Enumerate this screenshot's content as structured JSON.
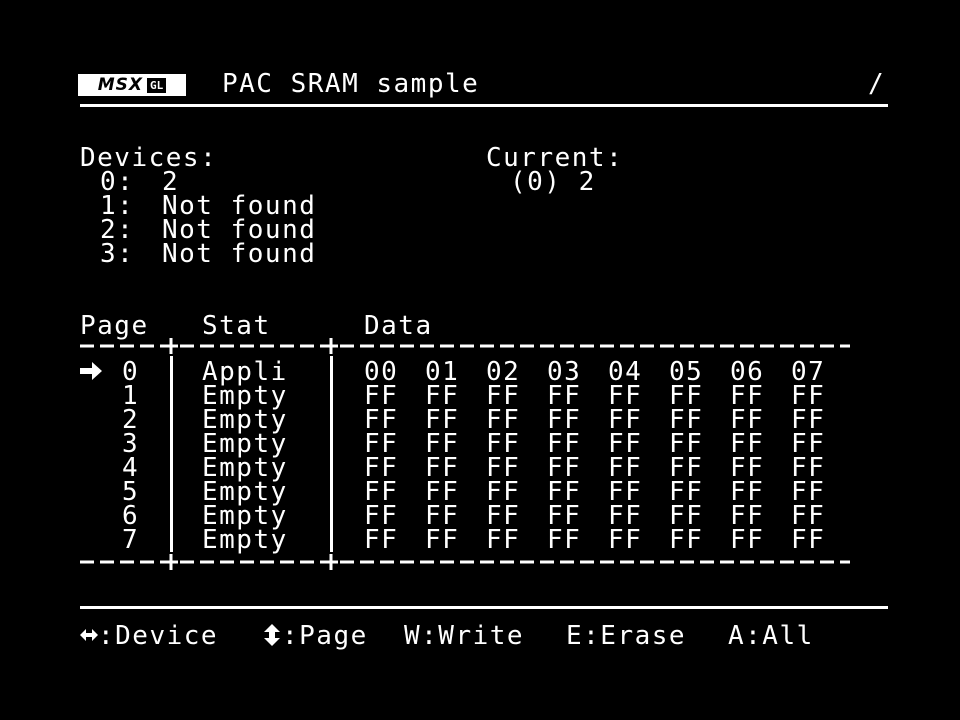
{
  "header": {
    "logo_text": "MSX",
    "logo_badge": "GL",
    "title": "PAC SRAM sample",
    "cursor_glyph": "/"
  },
  "devices": {
    "label": "Devices:",
    "items": [
      {
        "index": "0:",
        "value": "2"
      },
      {
        "index": "1:",
        "value": "Not found"
      },
      {
        "index": "2:",
        "value": "Not found"
      },
      {
        "index": "3:",
        "value": "Not found"
      }
    ]
  },
  "current": {
    "label": "Current:",
    "value": "(0) 2"
  },
  "table": {
    "headers": {
      "page": "Page",
      "stat": "Stat",
      "data": "Data"
    },
    "selected_marker_icon": "right-arrow-icon",
    "rows": [
      {
        "page": "0",
        "stat": "Appli",
        "data": [
          "00",
          "01",
          "02",
          "03",
          "04",
          "05",
          "06",
          "07"
        ],
        "selected": true
      },
      {
        "page": "1",
        "stat": "Empty",
        "data": [
          "FF",
          "FF",
          "FF",
          "FF",
          "FF",
          "FF",
          "FF",
          "FF"
        ]
      },
      {
        "page": "2",
        "stat": "Empty",
        "data": [
          "FF",
          "FF",
          "FF",
          "FF",
          "FF",
          "FF",
          "FF",
          "FF"
        ]
      },
      {
        "page": "3",
        "stat": "Empty",
        "data": [
          "FF",
          "FF",
          "FF",
          "FF",
          "FF",
          "FF",
          "FF",
          "FF"
        ]
      },
      {
        "page": "4",
        "stat": "Empty",
        "data": [
          "FF",
          "FF",
          "FF",
          "FF",
          "FF",
          "FF",
          "FF",
          "FF"
        ]
      },
      {
        "page": "5",
        "stat": "Empty",
        "data": [
          "FF",
          "FF",
          "FF",
          "FF",
          "FF",
          "FF",
          "FF",
          "FF"
        ]
      },
      {
        "page": "6",
        "stat": "Empty",
        "data": [
          "FF",
          "FF",
          "FF",
          "FF",
          "FF",
          "FF",
          "FF",
          "FF"
        ]
      },
      {
        "page": "7",
        "stat": "Empty",
        "data": [
          "FF",
          "FF",
          "FF",
          "FF",
          "FF",
          "FF",
          "FF",
          "FF"
        ]
      }
    ]
  },
  "footer": {
    "device_icon": "left-right-arrow-icon",
    "device_label": ":Device",
    "page_icon": "up-down-arrow-icon",
    "page_label": ":Page",
    "write_label": "W:Write",
    "erase_label": "E:Erase",
    "all_label": "A:All"
  },
  "colors": {
    "background": "#000000",
    "foreground": "#ffffff"
  }
}
